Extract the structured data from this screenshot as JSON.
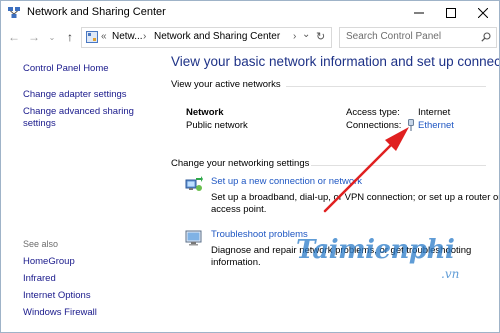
{
  "window": {
    "title": "Network and Sharing Center"
  },
  "address_bar": {
    "overflow": "«",
    "crumb1": "Netw...",
    "sep1": "›",
    "crumb2": "Network and Sharing Center",
    "sep2": "›",
    "search_placeholder": "Search Control Panel"
  },
  "left_pane": {
    "links": [
      {
        "label": "Control Panel Home"
      },
      {
        "label": "Change adapter settings"
      },
      {
        "label": "Change advanced sharing"
      },
      {
        "label": "settings"
      }
    ],
    "see_also_heading": "See also",
    "see_also": [
      {
        "label": "HomeGroup"
      },
      {
        "label": "Infrared"
      },
      {
        "label": "Internet Options"
      },
      {
        "label": "Windows Firewall"
      }
    ]
  },
  "main": {
    "title": "View your basic network information and set up connections",
    "active_networks": {
      "heading": "View your active networks",
      "network_name": "Network",
      "network_type": "Public network",
      "access_type_label": "Access type:",
      "access_type_value": "Internet",
      "connections_label": "Connections:",
      "connection_name": "Ethernet"
    },
    "settings": {
      "heading": "Change your networking settings",
      "tasks": [
        {
          "link": "Set up a new connection or network",
          "desc1": "Set up a broadband, dial-up, or VPN connection; or set up a router or",
          "desc2": "access point."
        },
        {
          "link": "Troubleshoot problems",
          "desc1": "Diagnose and repair network problems, or get troubleshooting",
          "desc2": "information."
        }
      ]
    }
  },
  "watermark": {
    "brand": "Taimienphi",
    "suffix": ".vn"
  },
  "colors": {
    "title_blue": "#1e3287",
    "link_blue": "#1f57c3",
    "nav_link": "#1a1a8c",
    "annotation_red": "#e02020"
  }
}
